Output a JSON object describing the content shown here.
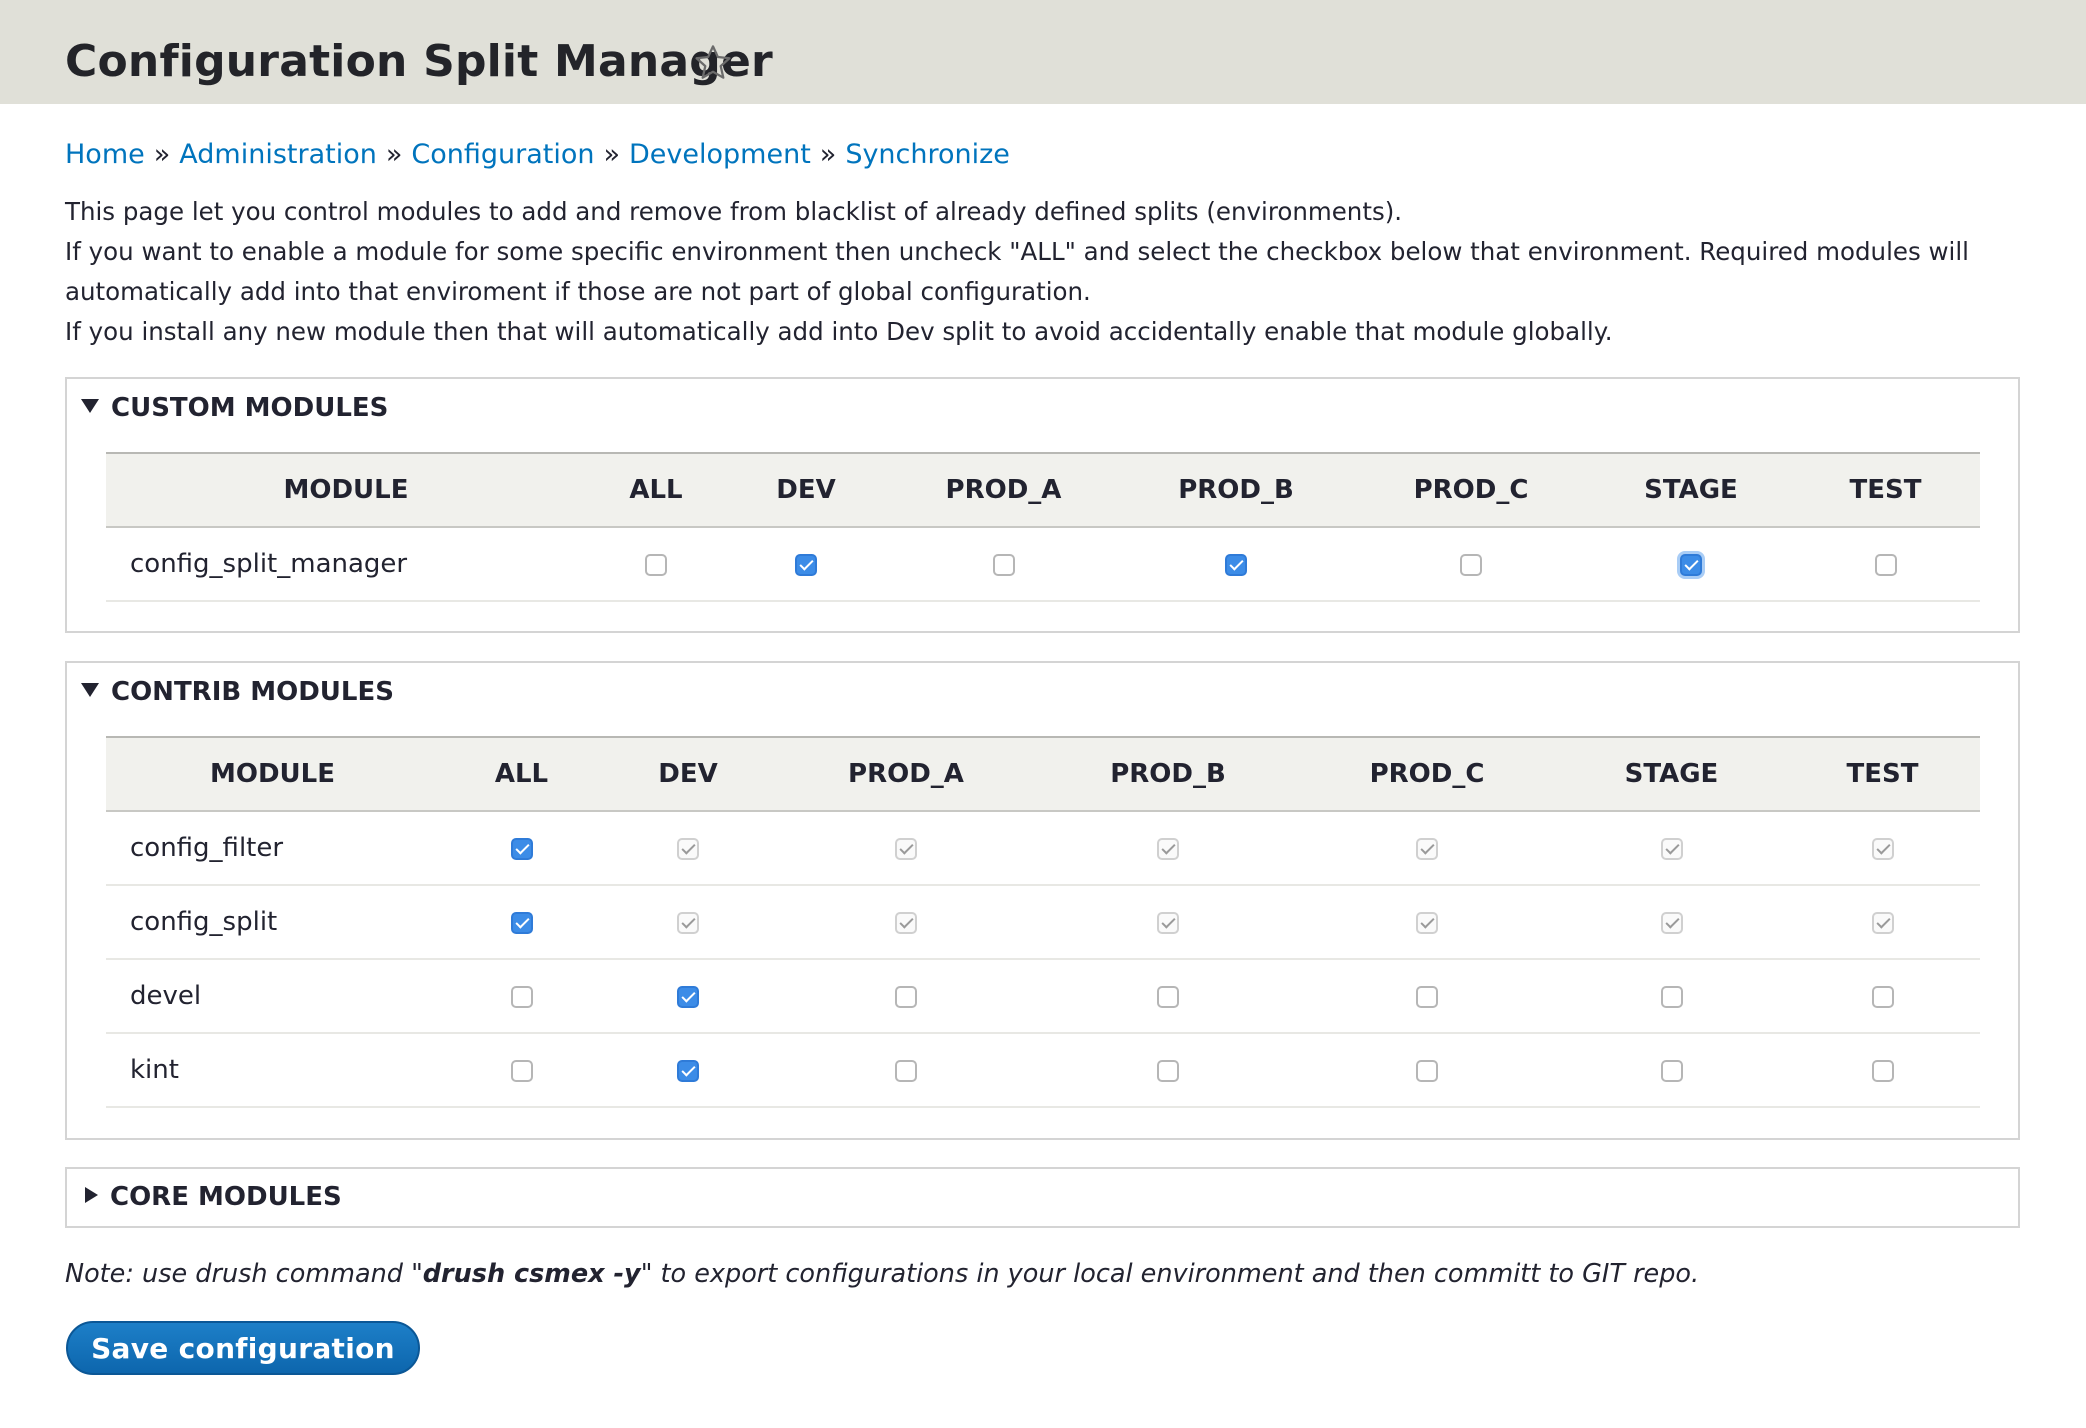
{
  "header": {
    "title": "Configuration Split Manager"
  },
  "breadcrumb": {
    "items": [
      "Home",
      "Administration",
      "Configuration",
      "Development",
      "Synchronize"
    ],
    "separator": "»"
  },
  "intro": {
    "line1": "This page let you control modules to add and remove from blacklist of already defined splits (environments).",
    "line2": "If you want to enable a module for some specific environment then uncheck \"ALL\" and select the checkbox below that environment. Required modules will automatically add into that enviroment if those are not part of global configuration.",
    "line3": "If you install any new module then that will automatically add into Dev split to avoid accidentally enable that module globally."
  },
  "sections": {
    "custom": {
      "title": "CUSTOM MODULES",
      "expanded": true,
      "columns": [
        "MODULE",
        "ALL",
        "DEV",
        "PROD_A",
        "PROD_B",
        "PROD_C",
        "STAGE",
        "TEST"
      ],
      "rows": [
        {
          "name": "config_split_manager",
          "checks": [
            "unchecked",
            "checked",
            "unchecked",
            "checked",
            "unchecked",
            "checked",
            "unchecked"
          ]
        }
      ]
    },
    "contrib": {
      "title": "CONTRIB MODULES",
      "expanded": true,
      "columns": [
        "MODULE",
        "ALL",
        "DEV",
        "PROD_A",
        "PROD_B",
        "PROD_C",
        "STAGE",
        "TEST"
      ],
      "rows": [
        {
          "name": "config_filter",
          "checks": [
            "checked",
            "disabled",
            "disabled",
            "disabled",
            "disabled",
            "disabled",
            "disabled"
          ]
        },
        {
          "name": "config_split",
          "checks": [
            "checked",
            "disabled",
            "disabled",
            "disabled",
            "disabled",
            "disabled",
            "disabled"
          ]
        },
        {
          "name": "devel",
          "checks": [
            "unchecked",
            "checked",
            "unchecked",
            "unchecked",
            "unchecked",
            "unchecked",
            "unchecked"
          ]
        },
        {
          "name": "kint",
          "checks": [
            "unchecked",
            "checked",
            "unchecked",
            "unchecked",
            "unchecked",
            "unchecked",
            "unchecked"
          ]
        }
      ]
    },
    "core": {
      "title": "CORE MODULES",
      "expanded": false
    }
  },
  "note": {
    "prefix": "Note: use drush command \"",
    "command": "drush csmex -y",
    "suffix": "\" to export configurations in your local environment and then committ to GIT repo."
  },
  "actions": {
    "save_label": "Save configuration"
  },
  "colors": {
    "link": "#0074bd",
    "primary_button": "#1470b8",
    "checkbox_checked": "#3c8ce7",
    "header_bg": "#e0e0d8"
  }
}
